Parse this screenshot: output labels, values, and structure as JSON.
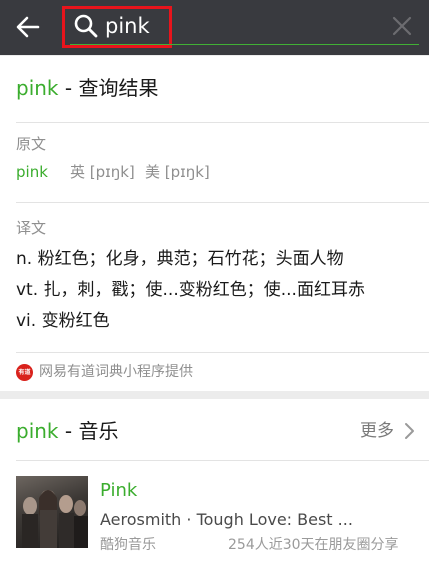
{
  "search": {
    "query": "pink"
  },
  "dict": {
    "title_word": "pink",
    "title_suffix": " - 查询结果",
    "original_label": "原文",
    "word": "pink",
    "phonetic_uk": "英 [pɪŋk]",
    "phonetic_us": "美 [pɪŋk]",
    "translation_label": "译文",
    "translations": [
      "n. 粉红色；化身，典范；石竹花；头面人物",
      "vt. 扎，刺，戳；使...变粉红色；使...面红耳赤",
      "vi. 变粉红色"
    ],
    "provider_icon_text": "有道",
    "provider": "网易有道词典小程序提供"
  },
  "music": {
    "title_word": "pink",
    "title_suffix": " - 音乐",
    "more_label": "更多",
    "song_title": "Pink",
    "artist": "Aerosmith · Tough Love: Best ...",
    "source": "酷狗音乐",
    "share_stat": "254人近30天在朋友圈分享"
  },
  "colors": {
    "accent_green": "#3bad2e",
    "topbar": "#393a3f",
    "highlight_red": "#e8141c"
  },
  "icons": [
    "back-arrow-icon",
    "search-icon",
    "clear-icon",
    "chevron-right-icon",
    "youdao-logo-icon"
  ]
}
